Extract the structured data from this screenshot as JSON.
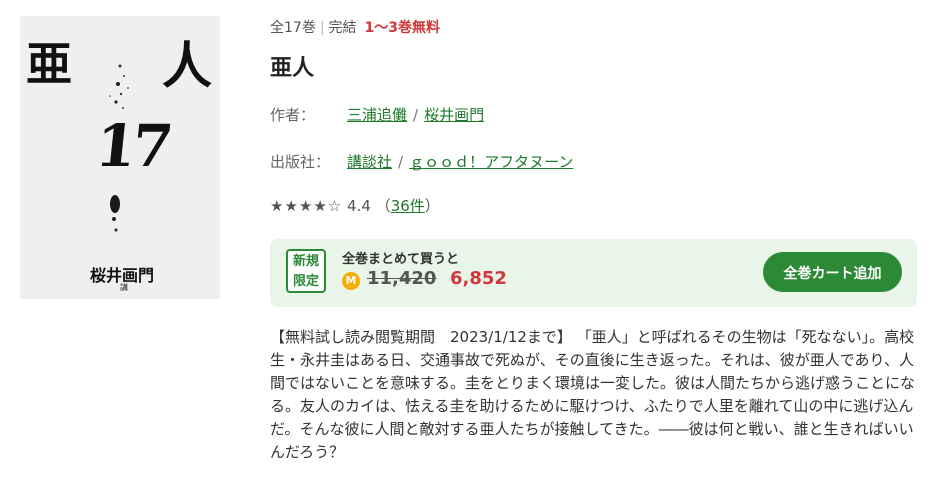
{
  "cover": {
    "title_char_1": "亜",
    "title_char_2": "人",
    "volume": "17",
    "author": "桜井画門",
    "publisher_mark": "講"
  },
  "meta": {
    "volumes": "全17巻",
    "status": "完結",
    "free_label": "1〜3巻無料"
  },
  "title": "亜人",
  "author_row": {
    "label": "作者：",
    "authors": [
      "三浦追儺",
      "桜井画門"
    ]
  },
  "publisher_row": {
    "label": "出版社：",
    "publishers": [
      "講談社",
      "ｇｏｏｄ！アフタヌーン"
    ]
  },
  "rating": {
    "stars": "★★★★☆",
    "value": "4.4",
    "count_open": "（",
    "count": "36件",
    "count_close": "）"
  },
  "bundle": {
    "badge_line1": "新規",
    "badge_line2": "限定",
    "lead": "全巻まとめて買うと",
    "coin_icon": "M",
    "price_old": "11,420",
    "price_new": "6,852",
    "cart_button": "全巻カート追加"
  },
  "description": "【無料試し読み閲覧期間　2023/1/12まで】 「亜人」と呼ばれるその生物は「死なない」。高校生・永井圭はある日、交通事故で死ぬが、その直後に生き返った。それは、彼が亜人であり、人間ではないことを意味する。圭をとりまく環境は一変した。彼は人間たちから逃げ惑うことになる。友人のカイは、怯える圭を助けるために駆けつけ、ふたりで人里を離れて山の中に逃げ込んだ。そんな彼に人間と敵対する亜人たちが接触してきた。――彼は何と戦い、誰と生きればいいんだろう？",
  "colors": {
    "accent_green": "#2c8a37",
    "link_green": "#1e7a2a",
    "price_red": "#d0383a",
    "panel_bg": "#e9f5e8"
  }
}
